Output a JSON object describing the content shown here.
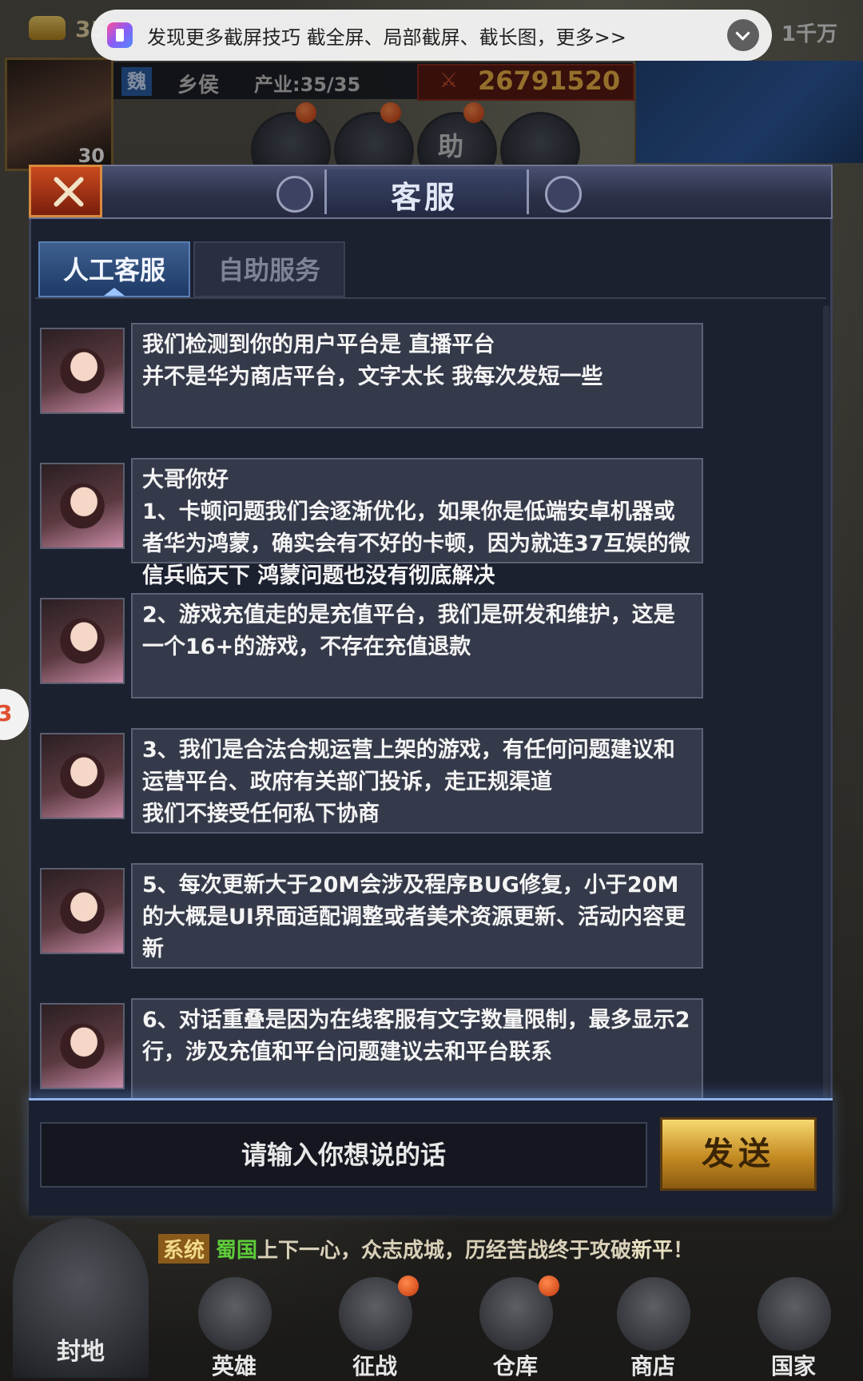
{
  "tip_banner": {
    "text": "发现更多截屏技巧   截全屏、局部截屏、截长图，更多>>"
  },
  "hud": {
    "gold_count": "35",
    "money_right": "1千万",
    "player_level": "30",
    "kingdom_badge": "魏",
    "rank": "乡侯",
    "industry": "产业:35/35",
    "power": "26791520",
    "assist_button": "助"
  },
  "dialog": {
    "title": "客服",
    "tabs": [
      {
        "label": "人工客服",
        "active": true
      },
      {
        "label": "自助服务",
        "active": false
      }
    ],
    "messages": [
      {
        "text": "我们检测到你的用户平台是 直播平台\n并不是华为商店平台，文字太长 我每次发短一些"
      },
      {
        "text": "大哥你好\n1、卡顿问题我们会逐渐优化，如果你是低端安卓机器或者华为鸿蒙，确实会有不好的卡顿，因为就连37互娱的微信兵临天下 鸿蒙问题也没有彻底解决"
      },
      {
        "text": "2、游戏充值走的是充值平台，我们是研发和维护，这是一个16+的游戏，不存在充值退款"
      },
      {
        "text": "3、我们是合法合规运营上架的游戏，有任何问题建议和运营平台、政府有关部门投诉，走正规渠道\n我们不接受任何私下协商"
      },
      {
        "text": "5、每次更新大于20M会涉及程序BUG修复，小于20M的大概是UI界面适配调整或者美术资源更新、活动内容更新"
      },
      {
        "text": "6、对话重叠是因为在线客服有文字数量限制，最多显示2行，涉及充值和平台问题建议去和平台联系"
      }
    ],
    "input_placeholder": "请输入你想说的话",
    "send_label": "发送"
  },
  "system_message": {
    "tag": "系统",
    "country": "蜀国",
    "text": "上下一心，众志成城，历经苦战终于攻破",
    "city": "新平",
    "end": "！"
  },
  "nav": {
    "home": "封地",
    "items": [
      "英雄",
      "征战",
      "仓库",
      "商店",
      "国家"
    ]
  },
  "side_float": "3"
}
